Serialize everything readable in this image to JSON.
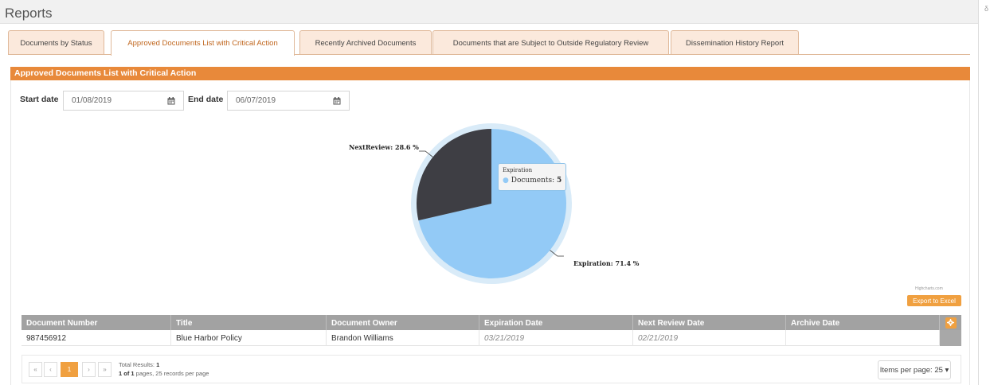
{
  "page": {
    "title": "Reports",
    "edge_glyph": "δ"
  },
  "tabs": [
    {
      "label": "Documents by Status",
      "active": false
    },
    {
      "label": "Approved Documents List with Critical Action",
      "active": true
    },
    {
      "label": "Recently Archived Documents",
      "active": false
    },
    {
      "label": "Documents that are Subject to Outside Regulatory Review",
      "active": false
    },
    {
      "label": "Dissemination History Report",
      "active": false
    }
  ],
  "panel": {
    "title": "Approved Documents List with Critical Action"
  },
  "filters": {
    "start_label": "Start date",
    "start_value": "01/08/2019",
    "end_label": "End date",
    "end_value": "06/07/2019",
    "calendar_icon": "calendar-icon"
  },
  "chart_data": {
    "type": "pie",
    "slices": [
      {
        "name": "Expiration",
        "value": 71.4,
        "color": "#93caf6",
        "label": "Expiration: 71.4 %"
      },
      {
        "name": "NextReview",
        "value": 28.6,
        "color": "#3e3e44",
        "label": "NextReview: 28.6 %"
      }
    ],
    "tooltip": {
      "title": "Expiration",
      "series": "Documents",
      "value": "5"
    },
    "credits": "Highcharts.com"
  },
  "actions": {
    "export_label": "Export to Excel"
  },
  "table": {
    "columns": [
      "Document Number",
      "Title",
      "Document Owner",
      "Expiration Date",
      "Next Review Date",
      "Archive Date"
    ],
    "rows": [
      [
        "987456912",
        "Blue Harbor Policy",
        "Brandon Williams",
        "03/21/2019",
        "02/21/2019",
        ""
      ]
    ]
  },
  "pager": {
    "first": "«",
    "prev": "‹",
    "current": "1",
    "next": "›",
    "last": "»",
    "total_label": "Total Results:",
    "total_value": "1",
    "pages_strong": "1 of 1",
    "pages_rest": " pages, 25 records per page",
    "items_per_page": "Items per page: 25 ▾"
  },
  "colors": {
    "accent": "#e8893a",
    "button": "#f0a040",
    "header_gray": "#a2a2a2"
  }
}
